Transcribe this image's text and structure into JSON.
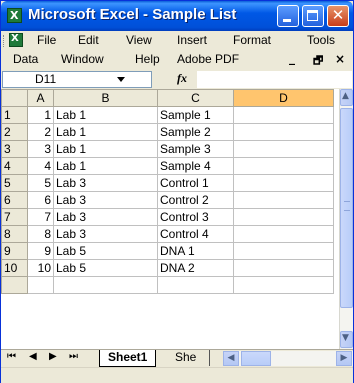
{
  "window": {
    "title": "Microsoft Excel - Sample List"
  },
  "menu": {
    "row1": [
      "File",
      "Edit",
      "View",
      "Insert",
      "Format",
      "Tools"
    ],
    "row2": [
      "Data",
      "Window",
      "Help",
      "Adobe PDF"
    ]
  },
  "formula_bar": {
    "name_box": "D11",
    "fx_label": "fx",
    "content": ""
  },
  "columns": [
    "A",
    "B",
    "C",
    "D"
  ],
  "rows": [
    {
      "row": "1",
      "a": "1",
      "b": "Lab 1",
      "c": "Sample 1",
      "d": ""
    },
    {
      "row": "2",
      "a": "2",
      "b": "Lab 1",
      "c": "Sample 2",
      "d": ""
    },
    {
      "row": "3",
      "a": "3",
      "b": "Lab 1",
      "c": "Sample 3",
      "d": ""
    },
    {
      "row": "4",
      "a": "4",
      "b": "Lab 1",
      "c": "Sample 4",
      "d": ""
    },
    {
      "row": "5",
      "a": "5",
      "b": "Lab 3",
      "c": "Control 1",
      "d": ""
    },
    {
      "row": "6",
      "a": "6",
      "b": "Lab 3",
      "c": "Control 2",
      "d": ""
    },
    {
      "row": "7",
      "a": "7",
      "b": "Lab 3",
      "c": "Control 3",
      "d": ""
    },
    {
      "row": "8",
      "a": "8",
      "b": "Lab 3",
      "c": "Control 4",
      "d": ""
    },
    {
      "row": "9",
      "a": "9",
      "b": "Lab 5",
      "c": "DNA 1",
      "d": ""
    },
    {
      "row": "10",
      "a": "10",
      "b": "Lab 5",
      "c": "DNA 2",
      "d": ""
    }
  ],
  "sheet_tabs": {
    "active": "Sheet1",
    "next": "She"
  },
  "colors": {
    "titlebar": "#0054e3",
    "selected_header": "#ffc56e",
    "chrome": "#ece9d8"
  },
  "icons": [
    "excel-app-icon",
    "minimize-icon",
    "maximize-icon",
    "close-icon",
    "workbook-icon"
  ]
}
